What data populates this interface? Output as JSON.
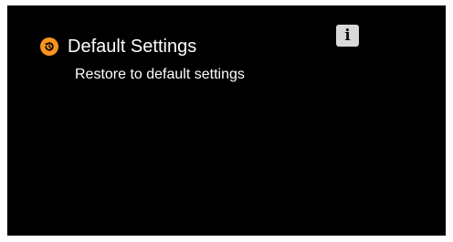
{
  "header": {
    "icon": "restore-icon",
    "title": "Default Settings"
  },
  "info_button": {
    "icon": "info-icon",
    "label": "i"
  },
  "options": [
    {
      "label": "Restore to default settings"
    }
  ],
  "colors": {
    "background": "#000000",
    "accent": "#f7941d",
    "text": "#ffffff",
    "button_bg": "#d9d9d9"
  }
}
